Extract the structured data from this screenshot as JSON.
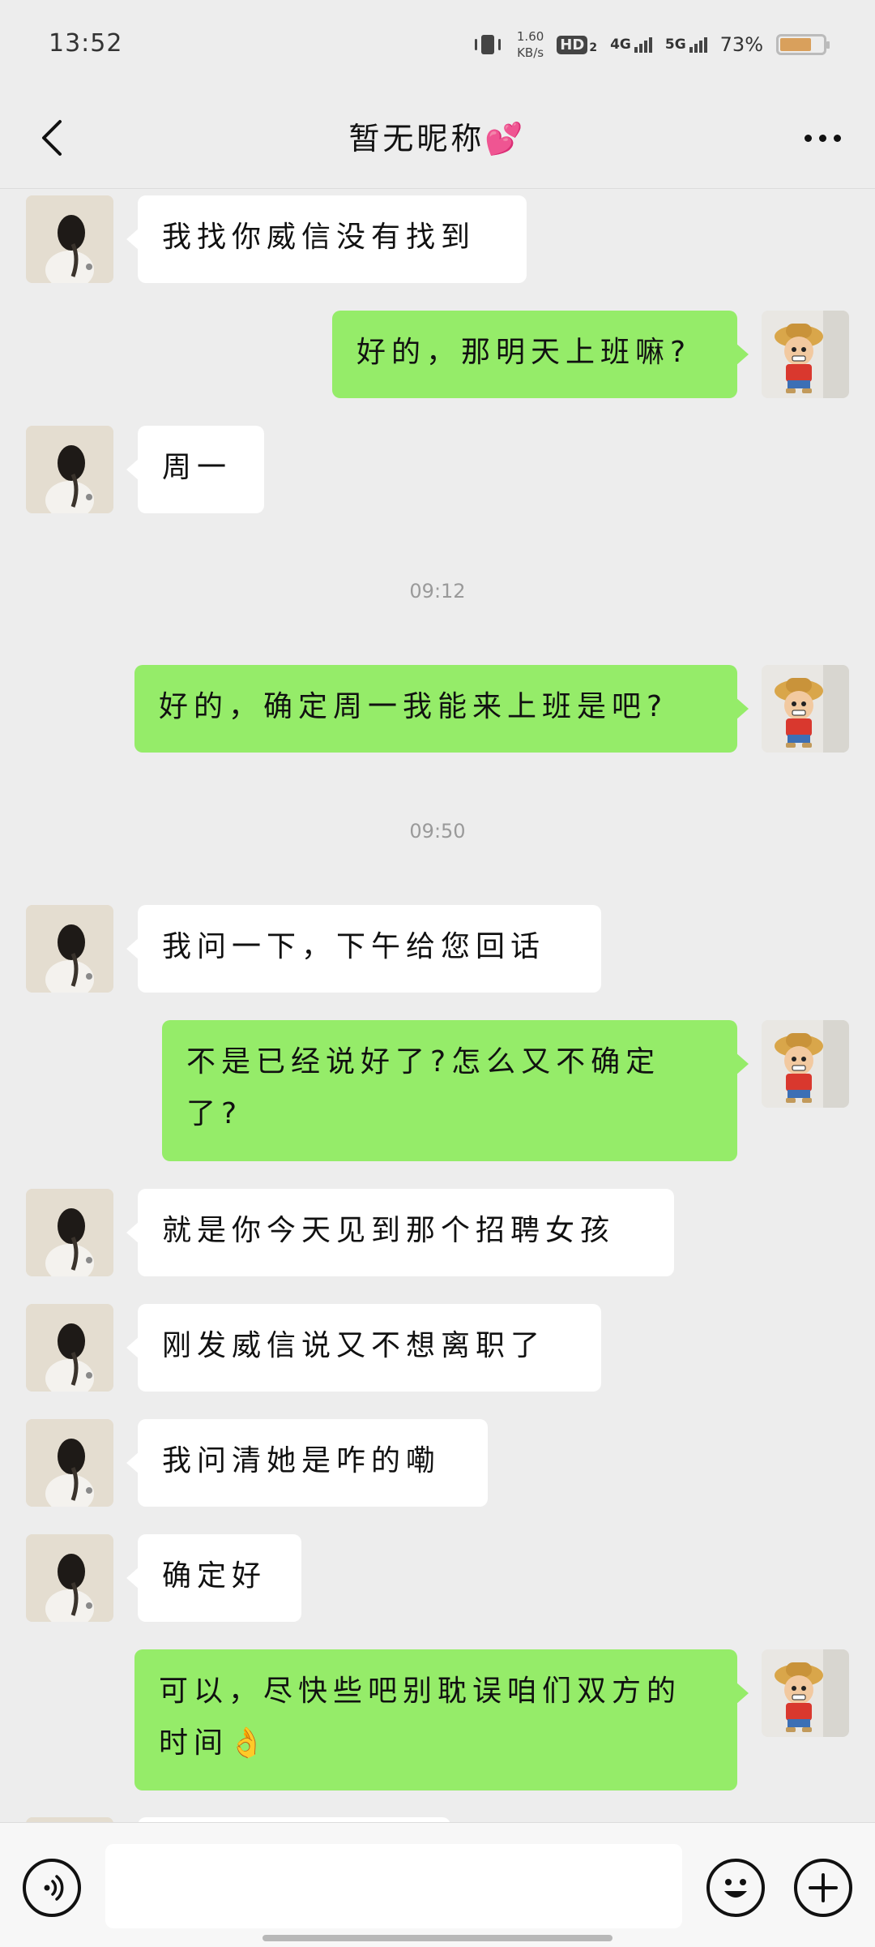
{
  "status_bar": {
    "time": "13:52",
    "net_speed_value": "1.60",
    "net_speed_unit": "KB/s",
    "hd_label": "HD",
    "hd_sub": "2",
    "signal_1_label": "4G",
    "signal_2_label": "5G",
    "battery_percent": "73%",
    "battery_level": 0.73,
    "battery_color": "#d9a05c"
  },
  "nav": {
    "title": "暂无昵称💕",
    "back_icon": "chevron-left-icon",
    "more_icon": "more-horizontal-icon"
  },
  "colors": {
    "background": "#ededed",
    "my_bubble": "#95ec69",
    "other_bubble": "#ffffff",
    "timestamp_text": "#9a9a9a"
  },
  "messages": [
    {
      "from": "other",
      "text": "我找你威信没有找到"
    },
    {
      "from": "me",
      "text": "好的，那明天上班嘛?"
    },
    {
      "from": "other",
      "text": "周一"
    },
    {
      "type": "time",
      "text": "09:12"
    },
    {
      "from": "me",
      "text": "好的，确定周一我能来上班是吧?"
    },
    {
      "type": "time",
      "text": "09:50"
    },
    {
      "from": "other",
      "text": "我问一下，下午给您回话"
    },
    {
      "from": "me",
      "text": "不是已经说好了?怎么又不确定了?"
    },
    {
      "from": "other",
      "text": "就是你今天见到那个招聘女孩"
    },
    {
      "from": "other",
      "text": "刚发威信说又不想离职了"
    },
    {
      "from": "other",
      "text": "我问清她是咋的嘞"
    },
    {
      "from": "other",
      "text": "确定好"
    },
    {
      "from": "me",
      "text": "可以，尽快些吧别耽误咱们双方的时间👌"
    }
  ],
  "input_bar": {
    "voice_icon": "voice-icon",
    "emoji_icon": "emoji-icon",
    "plus_icon": "plus-icon",
    "placeholder": ""
  }
}
